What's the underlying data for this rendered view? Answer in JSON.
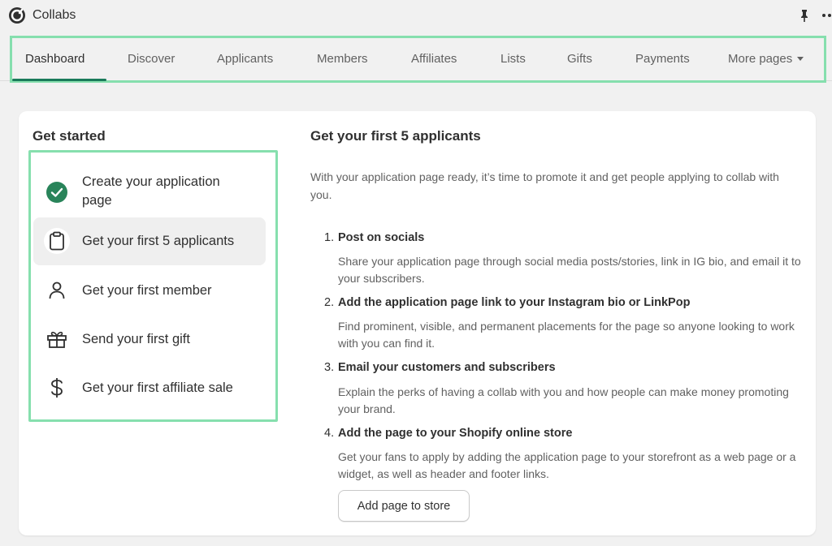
{
  "app": {
    "title": "Collabs",
    "logo_icon": "collabs-logo-icon"
  },
  "nav": {
    "tabs": [
      {
        "label": "Dashboard",
        "active": true
      },
      {
        "label": "Discover"
      },
      {
        "label": "Applicants"
      },
      {
        "label": "Members"
      },
      {
        "label": "Affiliates"
      },
      {
        "label": "Lists"
      },
      {
        "label": "Gifts"
      },
      {
        "label": "Payments"
      },
      {
        "label": "More pages"
      }
    ]
  },
  "get_started": {
    "title": "Get started",
    "steps": [
      {
        "label_line1": "Create your application",
        "label_line2": "page",
        "icon": "check-circle-icon",
        "completed": true
      },
      {
        "label": "Get your first 5 applicants",
        "icon": "clipboard-icon",
        "active": true
      },
      {
        "label": "Get your first member",
        "icon": "person-icon"
      },
      {
        "label": "Send your first gift",
        "icon": "gift-icon"
      },
      {
        "label": "Get your first affiliate sale",
        "icon": "dollar-icon"
      }
    ]
  },
  "detail": {
    "title": "Get your first 5 applicants",
    "intro": "With your application page ready, it’s time to promote it and get people applying to collab with you.",
    "items": [
      {
        "num": "1.",
        "title": "Post on socials",
        "desc": "Share your application page through social media posts/stories, link in IG bio, and email it to your subscribers."
      },
      {
        "num": "2.",
        "title": "Add the application page link to your Instagram bio or LinkPop",
        "desc": "Find prominent, visible, and permanent placements for the page so anyone looking to work with you can find it."
      },
      {
        "num": "3.",
        "title": "Email your customers and subscribers",
        "desc": "Explain the perks of having a collab with you and how people can make money promoting your brand."
      },
      {
        "num": "4.",
        "title": "Add the page to your Shopify online store",
        "desc": "Get your fans to apply by adding the application page to your storefront as a web page or a widget, as well as header and footer links."
      }
    ],
    "button_label": "Add page to store"
  },
  "colors": {
    "accent": "#1a7a5a",
    "highlight_border": "#86dfae",
    "check_green": "#29845a"
  }
}
